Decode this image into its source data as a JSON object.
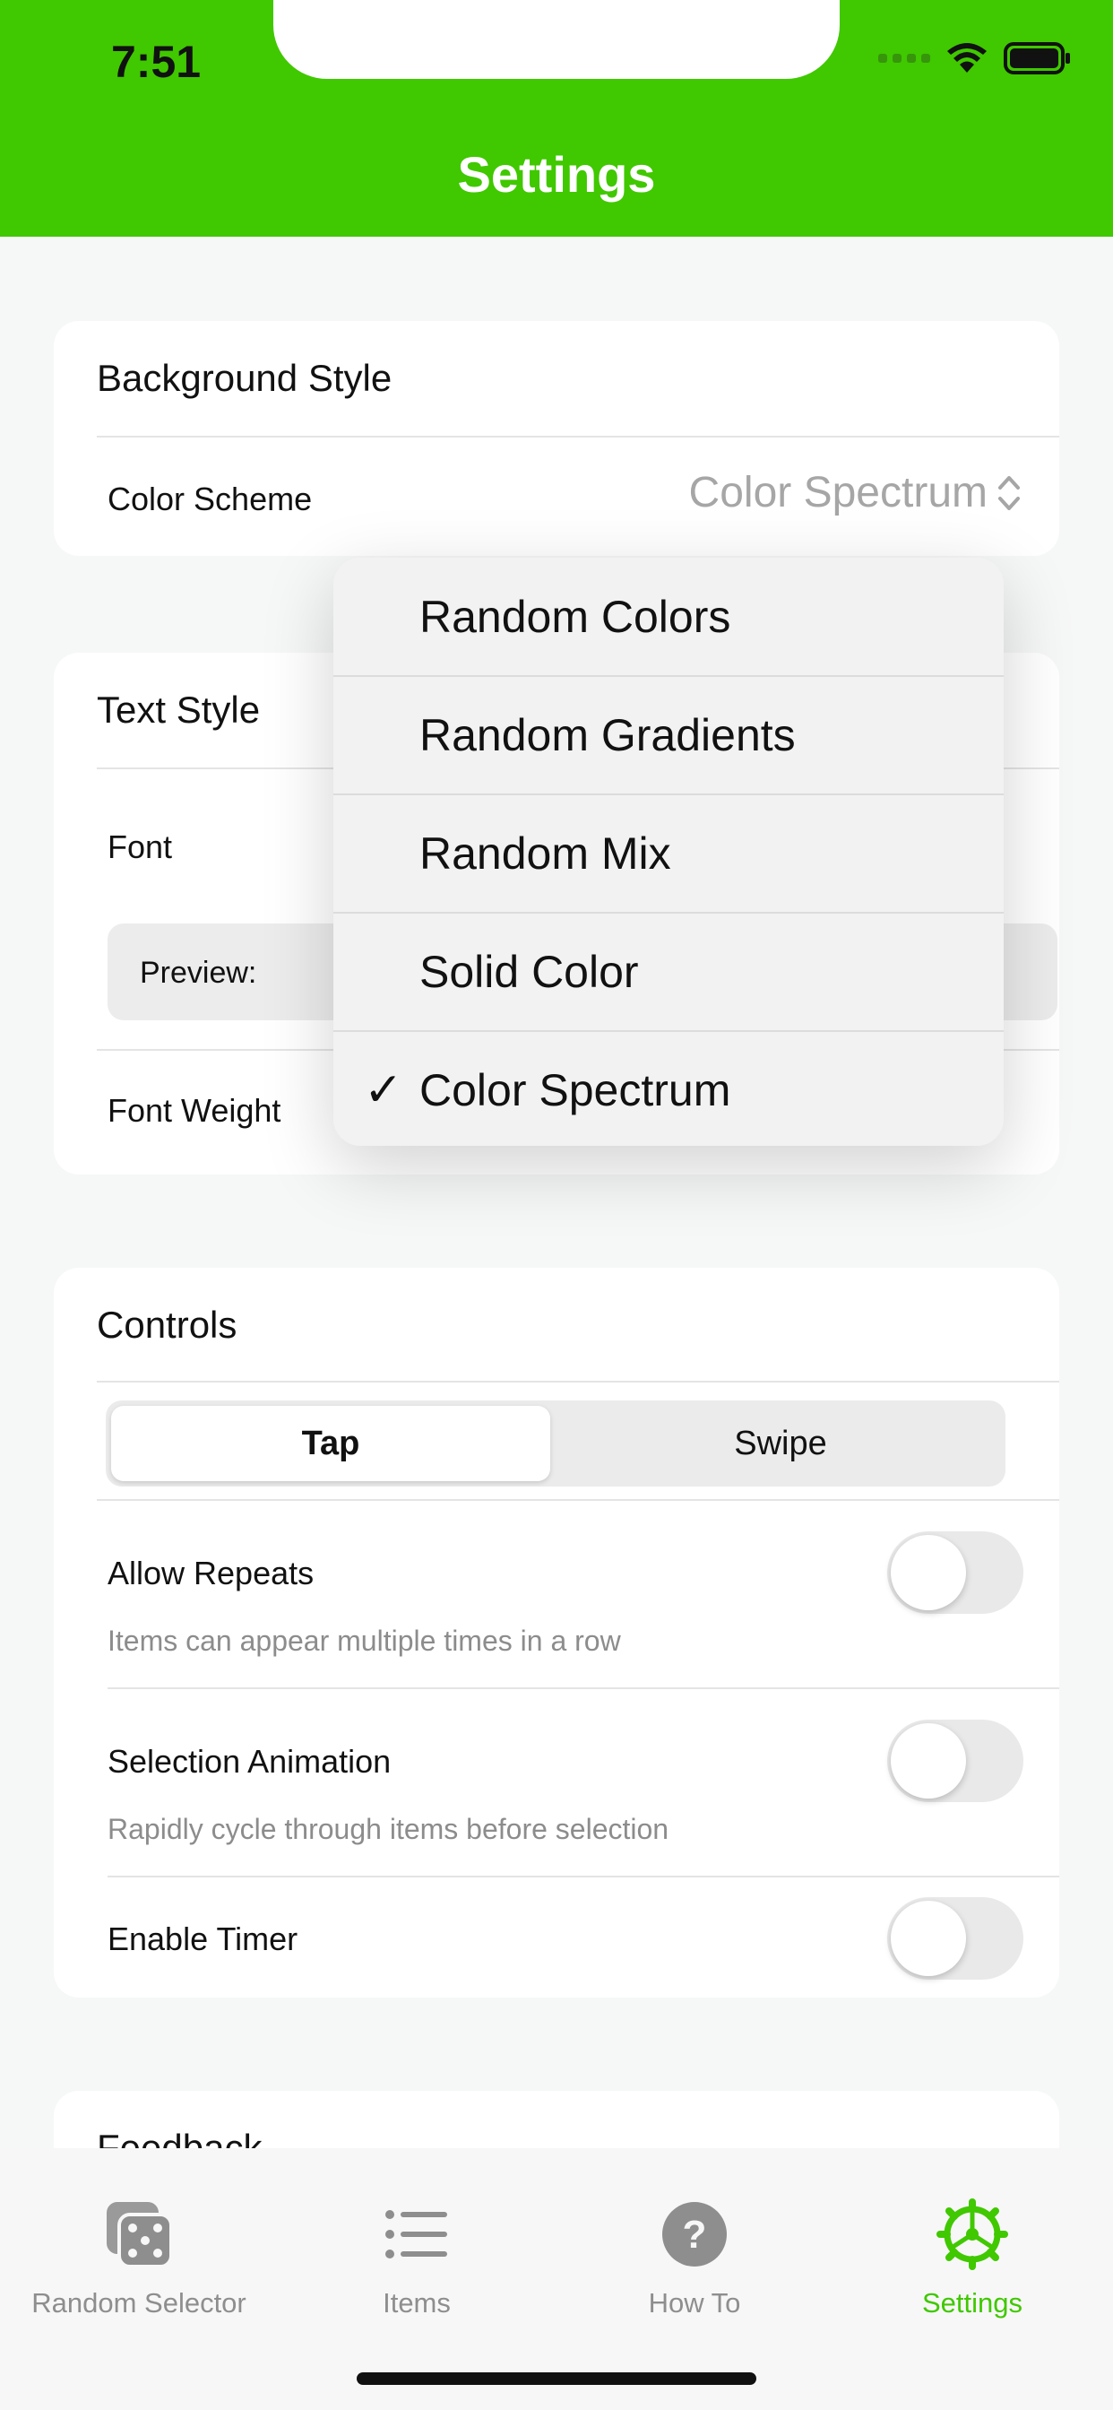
{
  "status_bar": {
    "time": "7:51"
  },
  "header": {
    "title": "Settings"
  },
  "background_style": {
    "title": "Background Style",
    "color_scheme_label": "Color Scheme",
    "color_scheme_value": "Color Spectrum"
  },
  "text_style": {
    "title": "Text Style",
    "font_label": "Font",
    "preview_label": "Preview:",
    "font_weight_label": "Font Weight"
  },
  "controls": {
    "title": "Controls",
    "segments": [
      "Tap",
      "Swipe"
    ],
    "selected_segment": "Tap",
    "toggles": [
      {
        "label": "Allow Repeats",
        "caption": "Items can appear multiple times in a row",
        "on": false
      },
      {
        "label": "Selection Animation",
        "caption": "Rapidly cycle through items before selection",
        "on": false
      },
      {
        "label": "Enable Timer",
        "caption": "",
        "on": false
      }
    ]
  },
  "next_section_title_partial": "Feedback",
  "dropdown": {
    "options": [
      "Random Colors",
      "Random Gradients",
      "Random Mix",
      "Solid Color",
      "Color Spectrum"
    ],
    "selected": "Color Spectrum",
    "check_glyph": "✓"
  },
  "tabbar": {
    "tabs": [
      {
        "label": "Random Selector",
        "icon": "dice-icon",
        "active": false
      },
      {
        "label": "Items",
        "icon": "list-icon",
        "active": false
      },
      {
        "label": "How To",
        "icon": "question-icon",
        "active": false
      },
      {
        "label": "Settings",
        "icon": "gear-icon",
        "active": true
      }
    ]
  },
  "colors": {
    "accent": "#40c800",
    "menu_bg": "#f2f2f2",
    "caption_gray": "#8c8c8c"
  }
}
